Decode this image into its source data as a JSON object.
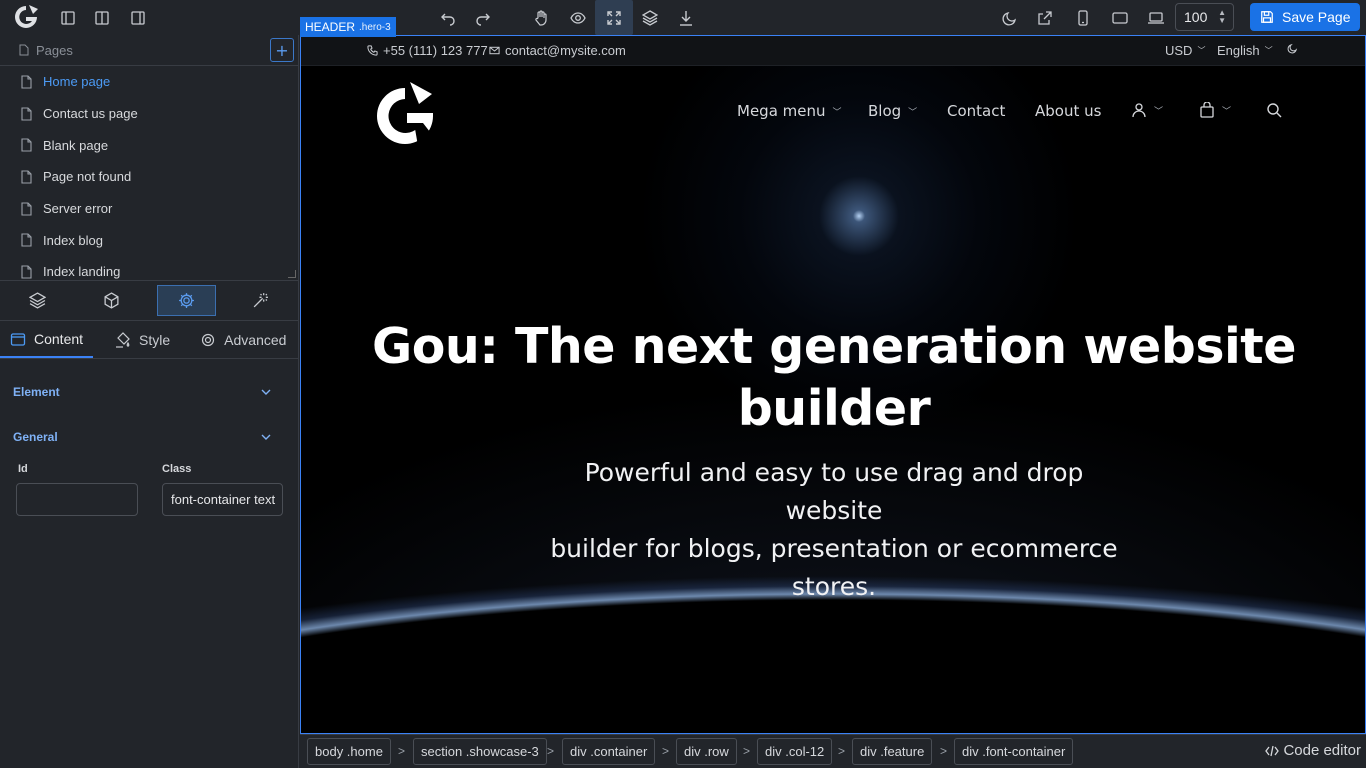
{
  "toolbar": {
    "save_label": "Save Page",
    "zoom_value": "100",
    "accent_color": "#1a72e6"
  },
  "pages": {
    "title": "Pages",
    "add_label": "+",
    "items": [
      {
        "label": "Home page",
        "active": true
      },
      {
        "label": "Contact us page"
      },
      {
        "label": "Blank page"
      },
      {
        "label": "Page not found"
      },
      {
        "label": "Server error"
      },
      {
        "label": "Index blog"
      },
      {
        "label": "Index landing"
      }
    ]
  },
  "properties": {
    "tabs": [
      {
        "label": "Content",
        "active": true
      },
      {
        "label": "Style"
      },
      {
        "label": "Advanced"
      }
    ],
    "sections": [
      {
        "label": "Element"
      },
      {
        "label": "General"
      }
    ],
    "fields": {
      "id_label": "Id",
      "id_value": "",
      "class_label": "Class",
      "class_value": "font-container text"
    }
  },
  "selection": {
    "tag": "HEADER",
    "class": ".hero-3"
  },
  "site": {
    "phone": "+55 (111) 123 777",
    "email": "contact@mysite.com",
    "currency": "USD",
    "language": "English",
    "nav": [
      "Mega menu",
      "Blog",
      "Contact",
      "About us"
    ],
    "hero_title_line1": "Gou: The next generation website",
    "hero_title_line2": "builder",
    "hero_subtitle_line1": "Powerful and easy to use drag and drop website",
    "hero_subtitle_line2": "builder for blogs, presentation or ecommerce",
    "hero_subtitle_line3": "stores."
  },
  "breadcrumb": [
    "body .home",
    "section .showcase-3",
    "div .container",
    "div .row",
    "div .col-12",
    "div .feature",
    "div .font-container"
  ],
  "code_editor_label": "Code editor"
}
